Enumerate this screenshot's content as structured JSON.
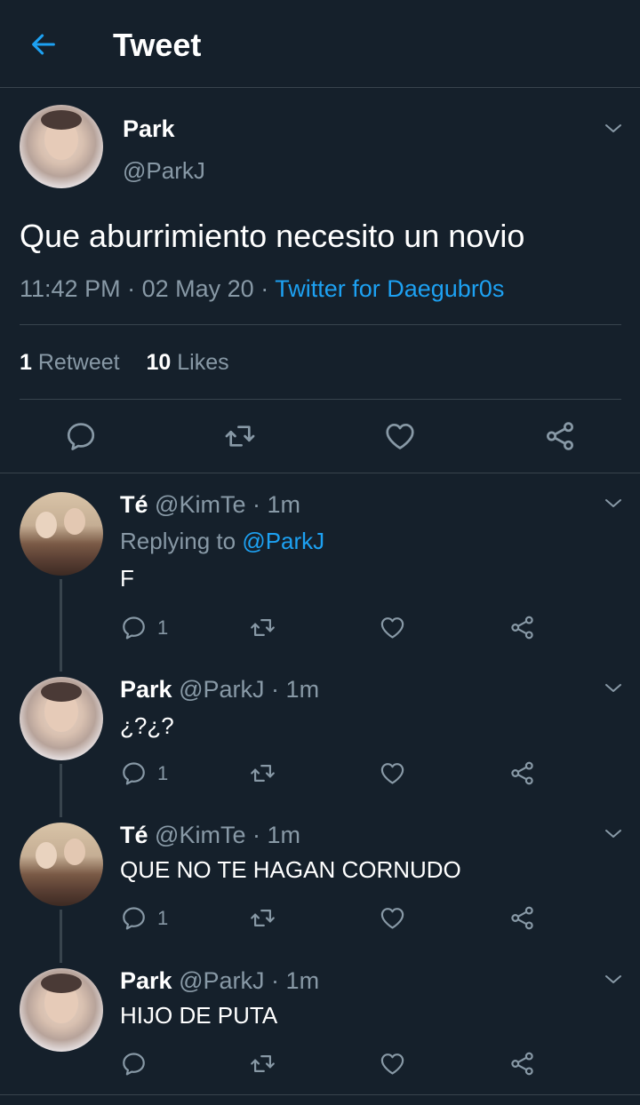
{
  "header": {
    "title": "Tweet",
    "back_icon": "arrow-left-icon"
  },
  "main_tweet": {
    "name": "Park",
    "handle": "@ParkJ",
    "text": "Que aburrimiento necesito un novio",
    "time": "11:42 PM",
    "sep": "·",
    "date": "02 May 20",
    "source": "Twitter for Daegubr0s",
    "retweets_count": "1",
    "retweets_label": "Retweet",
    "likes_count": "10",
    "likes_label": "Likes"
  },
  "replies": [
    {
      "name": "Té",
      "handle": "@KimTe",
      "sep": "·",
      "time": "1m",
      "replying_label": "Replying to",
      "replying_handle": "@ParkJ",
      "text": "F",
      "reply_count": "1"
    },
    {
      "name": "Park",
      "handle": "@ParkJ",
      "sep": "·",
      "time": "1m",
      "text": "¿?¿?",
      "reply_count": "1"
    },
    {
      "name": "Té",
      "handle": "@KimTe",
      "sep": "·",
      "time": "1m",
      "text": "QUE NO TE HAGAN CORNUDO",
      "reply_count": "1"
    },
    {
      "name": "Park",
      "handle": "@ParkJ",
      "sep": "·",
      "time": "1m",
      "text": "HIJO DE PUTA"
    }
  ],
  "colors": {
    "background": "#15202b",
    "accent": "#1da1f2",
    "muted": "#8899a6",
    "divider": "#38444d"
  },
  "icons": [
    "arrow-left-icon",
    "chevron-down-icon",
    "reply-icon",
    "retweet-icon",
    "like-icon",
    "share-icon"
  ]
}
